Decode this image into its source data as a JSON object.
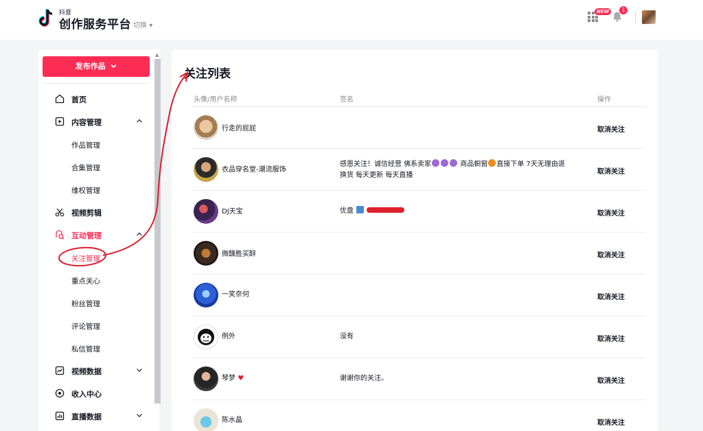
{
  "header": {
    "logo_small": "抖音",
    "logo_title": "创作服务平台",
    "switch_label": "切换",
    "new_badge": "NEW",
    "notification_count": "1"
  },
  "sidebar": {
    "publish_button": "发布作品",
    "items": [
      {
        "label": "首页",
        "icon": "home-icon"
      },
      {
        "label": "内容管理",
        "icon": "content-icon",
        "expanded": true
      },
      {
        "label": "视频剪辑",
        "icon": "scissors-icon"
      },
      {
        "label": "互动管理",
        "icon": "interaction-icon",
        "expanded": true,
        "active": true
      },
      {
        "label": "视频数据",
        "icon": "chart-icon",
        "expanded": false
      },
      {
        "label": "收入中心",
        "icon": "income-icon"
      },
      {
        "label": "直播数据",
        "icon": "live-data-icon",
        "expanded": false
      }
    ],
    "content_sub": [
      "作品管理",
      "合集管理",
      "维权管理"
    ],
    "interaction_sub": [
      "关注管理",
      "重点关心",
      "粉丝管理",
      "评论管理",
      "私信管理"
    ]
  },
  "main": {
    "title": "关注列表",
    "columns": [
      "头像/用户名称",
      "签名",
      "操作"
    ],
    "action_label": "取消关注",
    "rows": [
      {
        "name": "行走的屁屁",
        "signature": ""
      },
      {
        "name": "衣品穿名堂-潮流服饰",
        "signature_line1": "感恩关注！诚信经营 佛系卖家",
        "signature_mid": "商品橱窗",
        "signature_tail": "直接下单 7天无理由退",
        "signature_line2": "换货 每天更新 每天直播"
      },
      {
        "name": "DJ天宝",
        "signature": "优盘"
      },
      {
        "name": "微醺胜买醉",
        "signature": ""
      },
      {
        "name": "一笑奈何",
        "signature": ""
      },
      {
        "name": "例外",
        "signature": "没有"
      },
      {
        "name": "琴梦",
        "signature": "谢谢你的关注。"
      },
      {
        "name": "陈水晶",
        "signature": ""
      }
    ]
  },
  "colors": {
    "accent": "#fe2c55",
    "annotation": "#d81e2c"
  }
}
